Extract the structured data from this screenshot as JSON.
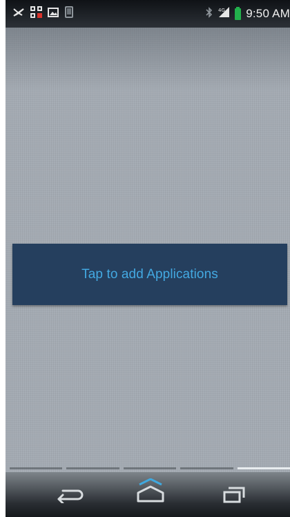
{
  "status_bar": {
    "left_icons": [
      "notification-muted-icon",
      "qr-code-icon",
      "image-icon",
      "tablet-icon"
    ],
    "right_icons": [
      "bluetooth-icon",
      "signal-4g-icon",
      "battery-icon"
    ],
    "time": "9:50 AM",
    "battery_color": "#22b14c"
  },
  "home": {
    "add_apps_label": "Tap to add Applications",
    "banner_color": "#253f5e",
    "label_color": "#43a9e2"
  },
  "page_indicator": {
    "pages": 5,
    "active_page": 5
  },
  "nav_bar": {
    "buttons": [
      "back-icon",
      "home-icon",
      "recent-apps-icon"
    ]
  }
}
